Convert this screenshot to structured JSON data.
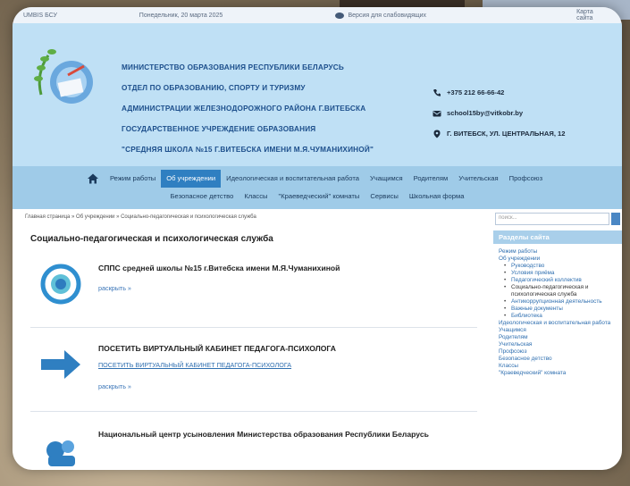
{
  "topbar": {
    "left": "UMBIS БСУ",
    "date": "Понедельник, 20 марта 2025",
    "vision": "Версия для слабовидящих",
    "right": "Карта сайта"
  },
  "header": {
    "org_lines": [
      "МИНИСТЕРСТВО ОБРАЗОВАНИЯ РЕСПУБЛИКИ БЕЛАРУСЬ",
      "ОТДЕЛ ПО ОБРАЗОВАНИЮ, СПОРТУ И ТУРИЗМУ",
      "АДМИНИСТРАЦИИ ЖЕЛЕЗНОДОРОЖНОГО РАЙОНА Г.ВИТЕБСКА",
      "ГОСУДАРСТВЕННОЕ УЧРЕЖДЕНИЕ ОБРАЗОВАНИЯ",
      "\"СРЕДНЯЯ ШКОЛА №15 Г.ВИТЕБСКА ИМЕНИ М.Я.ЧУМАНИХИНОЙ\""
    ],
    "phone": "+375 212 66-66-42",
    "email": "school15by@vitkobr.by",
    "address": "Г. ВИТЕБСК, УЛ. ЦЕНТРАЛЬНАЯ, 12"
  },
  "nav": {
    "row1": [
      "Режим работы",
      "Об учреждении",
      "Идеологическая и воспитательная работа",
      "Учащимся",
      "Родителям",
      "Учительская",
      "Профсоюз"
    ],
    "row2": [
      "Безопасное детство",
      "Классы",
      "\"Краеведческий\" комнаты",
      "Сервисы",
      "Школьная форма"
    ]
  },
  "content": {
    "breadcrumb": "Главная страница » Об учреждении » Социально-педагогическая и психологическая служба",
    "title": "Социально-педагогическая и психологическая служба",
    "entries": [
      {
        "title": "СППС средней школы №15 г.Витебска имени М.Я.Чуманихиной",
        "sub": "",
        "more": "раскрыть »"
      },
      {
        "title": "ПОСЕТИТЬ ВИРТУАЛЬНЫЙ КАБИНЕТ ПЕДАГОГА-ПСИХОЛОГА",
        "sub": "ПОСЕТИТЬ ВИРТУАЛЬНЫЙ КАБИНЕТ ПЕДАГОГА-ПСИХОЛОГА",
        "more": "раскрыть »"
      },
      {
        "title": "Национальный центр усыновления Министерства образования Республики Беларусь",
        "sub": "",
        "more": ""
      }
    ]
  },
  "sidebar": {
    "search_placeholder": "поиск...",
    "heading": "Разделы сайта",
    "items": [
      "Режим работы",
      "Об учреждении",
      "Руководство",
      "Условия приёма",
      "Педагогический коллектив",
      "Социально-педагогическая и психологическая служба",
      "Антикоррупционная деятельность",
      "Важные документы",
      "Библиотека",
      "Идеологическая и воспитательная работа",
      "Учащимся",
      "Родителям",
      "Учительская",
      "Профсоюз",
      "Безопасное детство",
      "Классы",
      "\"Краеведческий\" комната"
    ]
  },
  "colors": {
    "header_bg": "#bfe0f5",
    "nav_bg": "#9fcbe8",
    "nav_active": "#2f7fc1",
    "org_text": "#1d4f8c",
    "link": "#2f6fb0"
  },
  "icons": [
    "home-icon",
    "phone-icon",
    "email-icon",
    "location-icon",
    "eye-icon",
    "arrow-right-icon",
    "logo-emblem"
  ]
}
